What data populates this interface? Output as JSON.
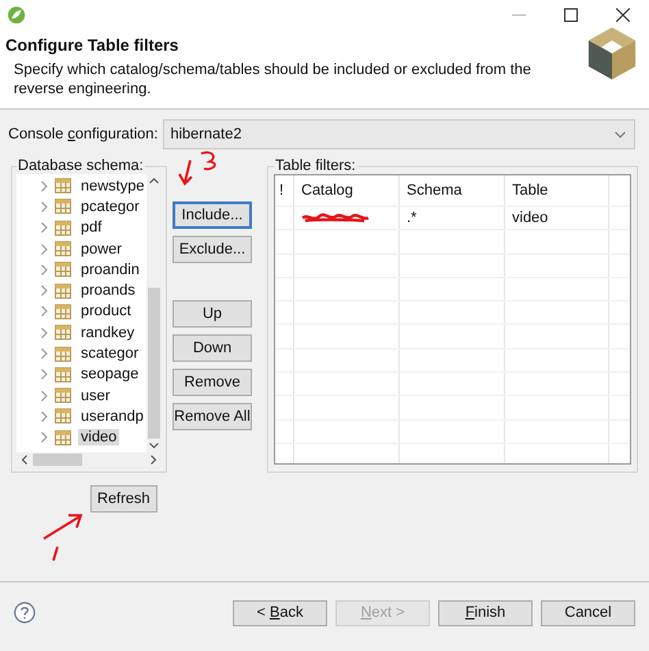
{
  "header": {
    "title": "Configure Table filters",
    "description": "Specify which catalog/schema/tables should be included or excluded from the reverse engineering."
  },
  "console": {
    "label": {
      "before": "Console ",
      "mnemonic": "c",
      "after": "onfiguration:"
    },
    "value": "hibernate2"
  },
  "schema_tree": {
    "label": "Database schema:",
    "items": [
      {
        "name": "newstype",
        "selected": false
      },
      {
        "name": "pcategor",
        "selected": false
      },
      {
        "name": "pdf",
        "selected": false
      },
      {
        "name": "power",
        "selected": false
      },
      {
        "name": "proandin",
        "selected": false
      },
      {
        "name": "proands",
        "selected": false
      },
      {
        "name": "product",
        "selected": false
      },
      {
        "name": "randkey",
        "selected": false
      },
      {
        "name": "scategor",
        "selected": false
      },
      {
        "name": "seopage",
        "selected": false
      },
      {
        "name": "user",
        "selected": false
      },
      {
        "name": "userandp",
        "selected": false
      },
      {
        "name": "video",
        "selected": true
      }
    ]
  },
  "filter_buttons": [
    {
      "label": "Include...",
      "focused": true
    },
    {
      "label": "Exclude...",
      "focused": false
    }
  ],
  "list_buttons": [
    {
      "label": "Up",
      "focused": false
    },
    {
      "label": "Down",
      "focused": false
    },
    {
      "label": "Remove",
      "focused": false
    },
    {
      "label": "Remove All",
      "focused": false
    }
  ],
  "refresh_button": "Refresh",
  "table_filters": {
    "label": "Table filters:",
    "columns": [
      "!",
      "Catalog",
      "Schema",
      "Table"
    ],
    "rows": [
      {
        "schema": ".*",
        "table": "video"
      }
    ]
  },
  "footer_buttons": [
    {
      "label": {
        "before": "< ",
        "mnemonic": "B",
        "after": "ack"
      },
      "disabled": false
    },
    {
      "label": {
        "mnemonic": "N",
        "after": "ext >"
      },
      "disabled": true
    },
    {
      "label": {
        "mnemonic": "F",
        "after": "inish"
      },
      "disabled": false
    },
    {
      "label": {
        "before": "Cancel"
      },
      "disabled": false
    }
  ]
}
